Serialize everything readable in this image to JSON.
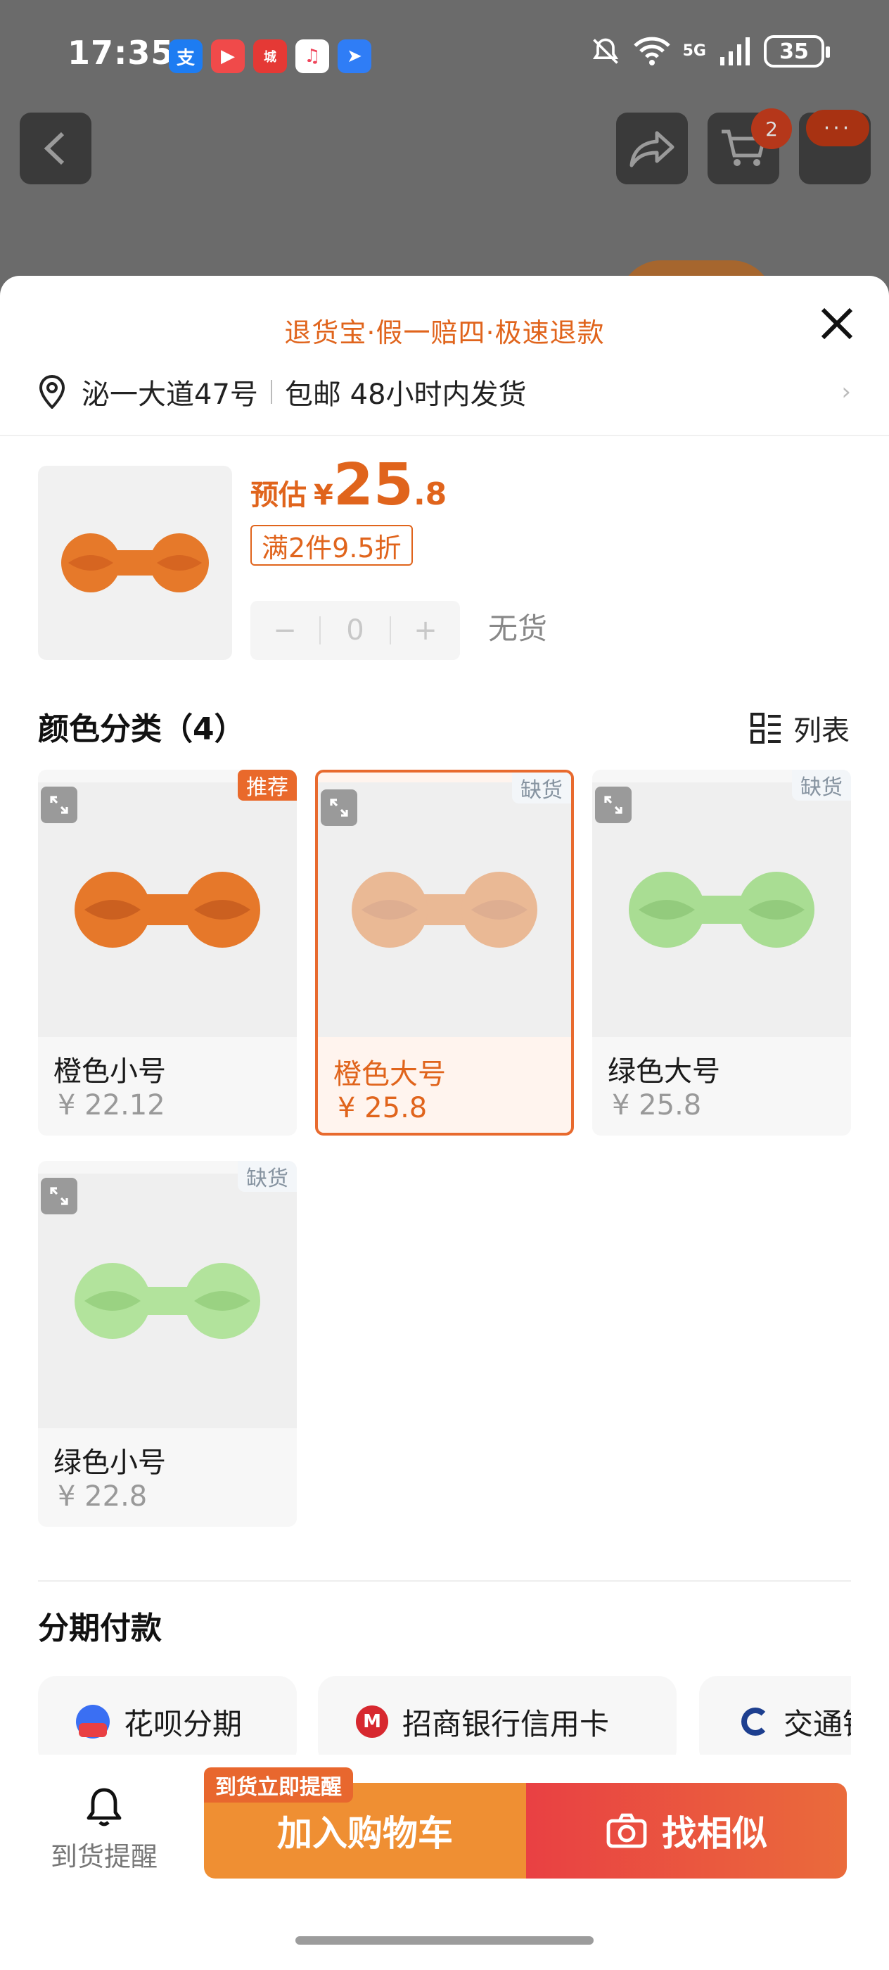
{
  "status": {
    "time": "17:35",
    "battery": "35",
    "network": "5G",
    "apps": [
      {
        "icon": "alipay-icon",
        "glyph": "支",
        "color": "#1d7cf2"
      },
      {
        "icon": "video-icon",
        "glyph": "▶",
        "color": "#f04a4a"
      },
      {
        "icon": "mall-icon",
        "glyph": "城",
        "color": "#e53935"
      },
      {
        "icon": "music-icon",
        "glyph": "♫",
        "color": "#ffffff"
      },
      {
        "icon": "dingtalk-icon",
        "glyph": "➤",
        "color": "#2f7df6"
      }
    ]
  },
  "nav": {
    "cart_badge": "2",
    "more_badge": "···"
  },
  "sheet": {
    "promo": "退货宝·假一赔四·极速退款",
    "address": "泌一大道47号",
    "shipping": "包邮 48小时内发货",
    "price_label": "预估",
    "price_yen": "¥",
    "price_int": "25",
    "price_dec": ".8",
    "discount": "满2件9.5折",
    "quantity": "0",
    "minus": "−",
    "plus": "+",
    "stock_status": "无货",
    "variants_title": "颜色分类（4）",
    "view_toggle": "列表",
    "variants": [
      {
        "name": "橙色小号",
        "price": "¥ 22.12",
        "tag": "推荐",
        "color": "orange"
      },
      {
        "name": "橙色大号",
        "price": "¥ 25.8",
        "tag": "缺货",
        "color": "orange"
      },
      {
        "name": "绿色大号",
        "price": "¥ 25.8",
        "tag": "缺货",
        "color": "green"
      },
      {
        "name": "绿色小号",
        "price": "¥ 22.8",
        "tag": "缺货",
        "color": "green"
      }
    ],
    "installment_title": "分期付款",
    "installments": [
      {
        "label": "花呗分期",
        "icon": "huabei-icon"
      },
      {
        "label": "招商银行信用卡",
        "icon": "cmb-icon"
      },
      {
        "label": "交通银",
        "icon": "bocom-icon"
      }
    ]
  },
  "bottom": {
    "notify_label": "到货提醒",
    "notify_tag": "到货立即提醒",
    "add_to_cart": "加入购物车",
    "find_similar": "找相似"
  },
  "colors": {
    "accent": "#e0641c",
    "cart_button": "#ef8f33",
    "similar_button": "#e94043"
  }
}
